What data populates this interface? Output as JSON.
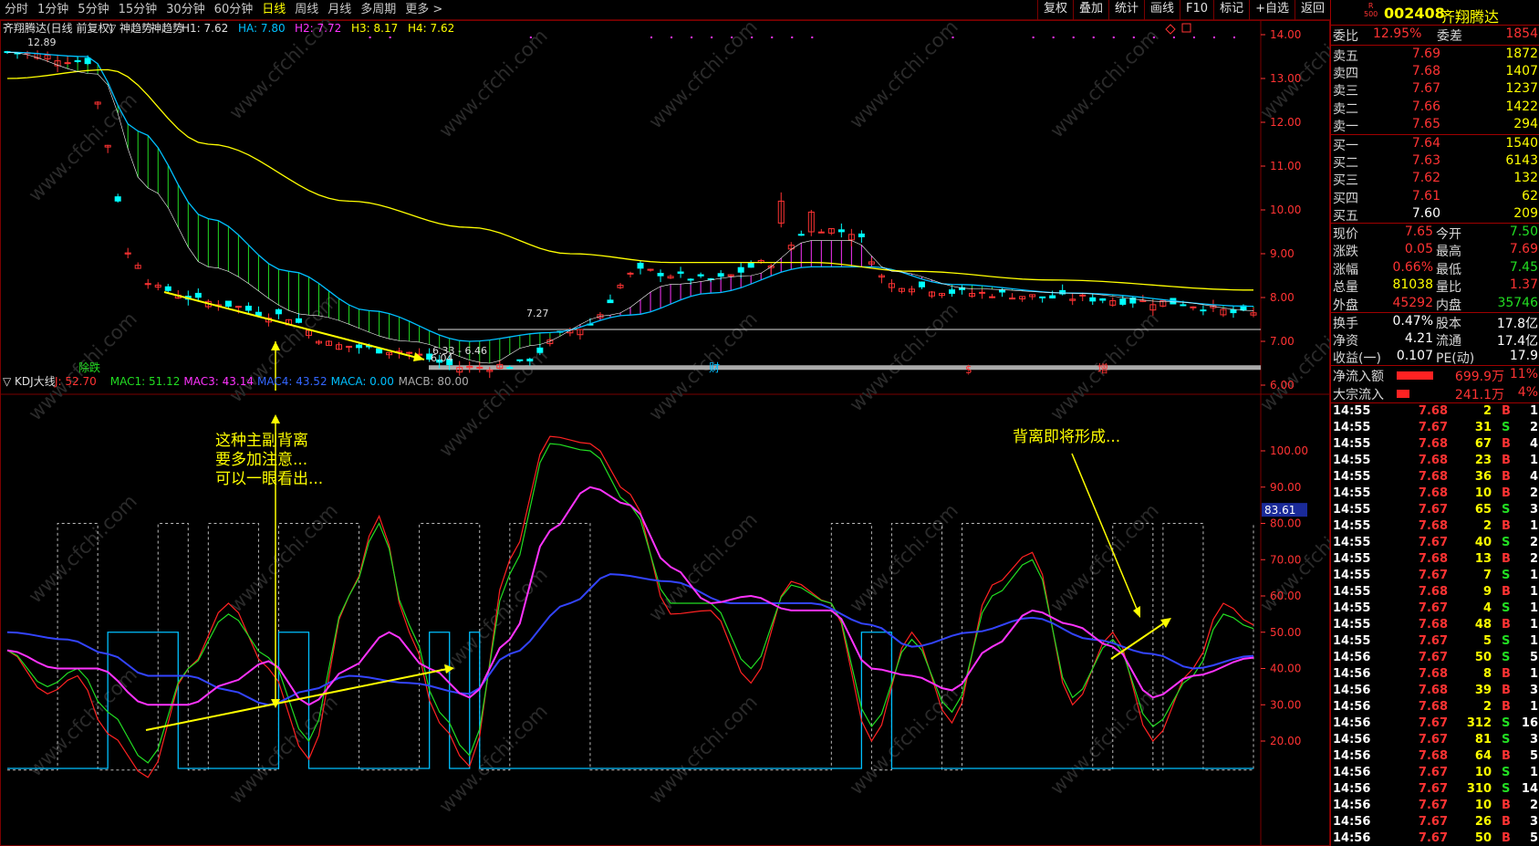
{
  "topbar": {
    "periods": [
      "分时",
      "1分钟",
      "5分钟",
      "15分钟",
      "30分钟",
      "60分钟",
      "日线",
      "周线",
      "月线",
      "多周期",
      "更多 >"
    ],
    "active_period": "日线",
    "tools": [
      "复权",
      "叠加",
      "统计",
      "画线",
      "F10",
      "标记",
      "+自选",
      "返回"
    ]
  },
  "chart": {
    "header": {
      "title": "齐翔腾达(日线 前复权)",
      "indicator": "▽ 神趋势",
      "indicator_name": "神趋势",
      "values": [
        {
          "label": "H1: 7.62",
          "color": "#e0e0e0"
        },
        {
          "label": "HA: 7.80",
          "color": "#00c0ff"
        },
        {
          "label": "H2: 7.72",
          "color": "#ff33ff"
        },
        {
          "label": "H3: 8.17",
          "color": "#ffff00"
        },
        {
          "label": "H4: 7.62",
          "color": "#ffff00"
        }
      ]
    },
    "price_axis": [
      "14.00",
      "13.00",
      "12.00",
      "11.00",
      "10.00",
      "9.00",
      "8.00",
      "7.00",
      "6.00"
    ],
    "price_notes": {
      "hi": "12.89",
      "low_label": "6.04",
      "range_label": "6.33 - 6.46",
      "mid_label": "7.27"
    },
    "markers": {
      "m1": "除跌",
      "m2": "财",
      "m3": "$",
      "m4": "增"
    },
    "kdj_header": {
      "title": "▽ KDJ大线",
      "values": [
        {
          "label": "J: 52.70",
          "color": "#ff3333"
        },
        {
          "label": "MAC1: 51.12",
          "color": "#22dd22"
        },
        {
          "label": "MAC3: 43.14",
          "color": "#ff33ff"
        },
        {
          "label": "MAC4: 43.52",
          "color": "#3366ff"
        },
        {
          "label": "MACA: 0.00",
          "color": "#00c0ff"
        },
        {
          "label": "MACB: 80.00",
          "color": "#aaaaaa"
        }
      ]
    },
    "kdj_axis": [
      "100.00",
      "90.00",
      "80.00",
      "70.00",
      "60.00",
      "50.00",
      "40.00",
      "30.00",
      "20.00"
    ],
    "kdj_marker": "83.61",
    "annotation_left": [
      "这种主副背离",
      "要多加注意...",
      "可以一眼看出..."
    ],
    "annotation_right": "背离即将形成...",
    "watermark": "www.cfchi.com"
  },
  "quote": {
    "code": "002408",
    "name": "齐翔腾达",
    "badge_top": "R",
    "badge_bottom": "500",
    "weibi": {
      "label": "委比",
      "value": "12.95%",
      "label2": "委差",
      "value2": "1854"
    },
    "asks": [
      {
        "label": "卖五",
        "price": "7.69",
        "vol": "1872"
      },
      {
        "label": "卖四",
        "price": "7.68",
        "vol": "1407"
      },
      {
        "label": "卖三",
        "price": "7.67",
        "vol": "1237"
      },
      {
        "label": "卖二",
        "price": "7.66",
        "vol": "1422"
      },
      {
        "label": "卖一",
        "price": "7.65",
        "vol": "294"
      }
    ],
    "bids": [
      {
        "label": "买一",
        "price": "7.64",
        "vol": "1540"
      },
      {
        "label": "买二",
        "price": "7.63",
        "vol": "6143"
      },
      {
        "label": "买三",
        "price": "7.62",
        "vol": "132"
      },
      {
        "label": "买四",
        "price": "7.61",
        "vol": "62"
      },
      {
        "label": "买五",
        "price": "7.60",
        "vol": "209"
      }
    ],
    "stats": [
      {
        "l1": "现价",
        "v1": "7.65",
        "c1": "red",
        "l2": "今开",
        "v2": "7.50",
        "c2": "green"
      },
      {
        "l1": "涨跌",
        "v1": "0.05",
        "c1": "red",
        "l2": "最高",
        "v2": "7.69",
        "c2": "red"
      },
      {
        "l1": "涨幅",
        "v1": "0.66%",
        "c1": "red",
        "l2": "最低",
        "v2": "7.45",
        "c2": "green"
      },
      {
        "l1": "总量",
        "v1": "81038",
        "c1": "yellow",
        "l2": "量比",
        "v2": "1.37",
        "c2": "red"
      },
      {
        "l1": "外盘",
        "v1": "45292",
        "c1": "red",
        "l2": "内盘",
        "v2": "35746",
        "c2": "green"
      }
    ],
    "stats2": [
      {
        "l1": "换手",
        "v1": "0.47%",
        "l2": "股本",
        "v2": "17.8亿"
      },
      {
        "l1": "净资",
        "v1": "4.21",
        "l2": "流通",
        "v2": "17.4亿"
      },
      {
        "l1": "收益(一)",
        "v1": "0.107",
        "l2": "PE(动)",
        "v2": "17.9"
      }
    ],
    "flows": [
      {
        "label": "净流入额",
        "value": "699.9万",
        "pct": "11%",
        "bar": 0.8
      },
      {
        "label": "大宗流入",
        "value": "241.1万",
        "pct": "4%",
        "bar": 0.28
      }
    ],
    "trades": [
      {
        "time": "14:55",
        "price": "7.68",
        "vol": "2",
        "side": "B",
        "n": "1"
      },
      {
        "time": "14:55",
        "price": "7.67",
        "vol": "31",
        "side": "S",
        "n": "2"
      },
      {
        "time": "14:55",
        "price": "7.68",
        "vol": "67",
        "side": "B",
        "n": "4"
      },
      {
        "time": "14:55",
        "price": "7.68",
        "vol": "23",
        "side": "B",
        "n": "1"
      },
      {
        "time": "14:55",
        "price": "7.68",
        "vol": "36",
        "side": "B",
        "n": "4"
      },
      {
        "time": "14:55",
        "price": "7.68",
        "vol": "10",
        "side": "B",
        "n": "2"
      },
      {
        "time": "14:55",
        "price": "7.67",
        "vol": "65",
        "side": "S",
        "n": "3"
      },
      {
        "time": "14:55",
        "price": "7.68",
        "vol": "2",
        "side": "B",
        "n": "1"
      },
      {
        "time": "14:55",
        "price": "7.67",
        "vol": "40",
        "side": "S",
        "n": "2"
      },
      {
        "time": "14:55",
        "price": "7.68",
        "vol": "13",
        "side": "B",
        "n": "2"
      },
      {
        "time": "14:55",
        "price": "7.67",
        "vol": "7",
        "side": "S",
        "n": "1"
      },
      {
        "time": "14:55",
        "price": "7.68",
        "vol": "9",
        "side": "B",
        "n": "1"
      },
      {
        "time": "14:55",
        "price": "7.67",
        "vol": "4",
        "side": "S",
        "n": "1"
      },
      {
        "time": "14:55",
        "price": "7.68",
        "vol": "48",
        "side": "B",
        "n": "1"
      },
      {
        "time": "14:55",
        "price": "7.67",
        "vol": "5",
        "side": "S",
        "n": "1"
      },
      {
        "time": "14:56",
        "price": "7.67",
        "vol": "50",
        "side": "S",
        "n": "5"
      },
      {
        "time": "14:56",
        "price": "7.68",
        "vol": "8",
        "side": "B",
        "n": "1"
      },
      {
        "time": "14:56",
        "price": "7.68",
        "vol": "39",
        "side": "B",
        "n": "3"
      },
      {
        "time": "14:56",
        "price": "7.68",
        "vol": "2",
        "side": "B",
        "n": "1"
      },
      {
        "time": "14:56",
        "price": "7.67",
        "vol": "312",
        "side": "S",
        "n": "16"
      },
      {
        "time": "14:56",
        "price": "7.67",
        "vol": "81",
        "side": "S",
        "n": "3"
      },
      {
        "time": "14:56",
        "price": "7.68",
        "vol": "64",
        "side": "B",
        "n": "5"
      },
      {
        "time": "14:56",
        "price": "7.67",
        "vol": "10",
        "side": "S",
        "n": "1"
      },
      {
        "time": "14:56",
        "price": "7.67",
        "vol": "310",
        "side": "S",
        "n": "14"
      },
      {
        "time": "14:56",
        "price": "7.67",
        "vol": "10",
        "side": "B",
        "n": "2"
      },
      {
        "time": "14:56",
        "price": "7.67",
        "vol": "26",
        "side": "B",
        "n": "3"
      },
      {
        "time": "14:56",
        "price": "7.67",
        "vol": "50",
        "side": "B",
        "n": "5"
      }
    ]
  },
  "colors": {
    "up": "#ff3333",
    "down": "#22dd22",
    "bg": "#000000",
    "grid": "#7a0000",
    "cyan": "#00c0ff",
    "magenta": "#ff33ff",
    "yellow": "#ffff00",
    "blue": "#3344ff"
  }
}
